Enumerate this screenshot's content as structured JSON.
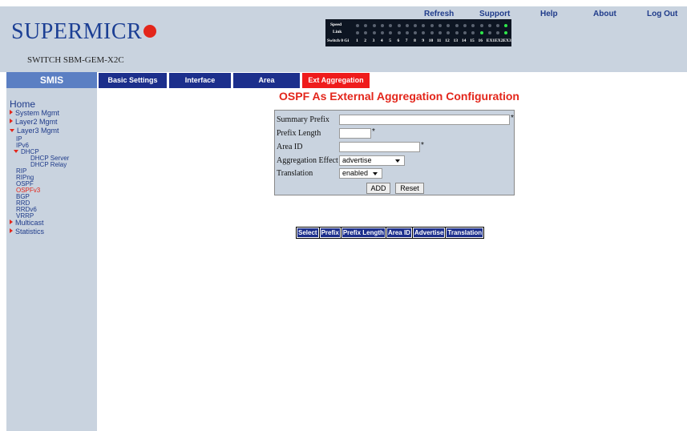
{
  "brand": {
    "logo_text": "SUPERMICR",
    "switch_name": "SWITCH SBM-GEM-X2C"
  },
  "top_links": [
    "Refresh",
    "Support",
    "Help",
    "About",
    "Log Out"
  ],
  "port_panel": {
    "speed_label": "Speed",
    "link_label": "Link",
    "switch_label": "Switch 0 Gi",
    "ports": [
      "1",
      "2",
      "3",
      "4",
      "5",
      "6",
      "7",
      "8",
      "9",
      "10",
      "11",
      "12",
      "13",
      "14",
      "15",
      "16",
      "EX1",
      "EX2",
      "EX3"
    ],
    "speed_on": [
      18
    ],
    "link_on": [
      15,
      18
    ]
  },
  "sidebar": {
    "title": "SMIS",
    "home": "Home",
    "items": [
      {
        "label": "System Mgmt",
        "arrow": "right"
      },
      {
        "label": "Layer2 Mgmt",
        "arrow": "right"
      },
      {
        "label": "Layer3 Mgmt",
        "arrow": "down"
      }
    ],
    "layer3_sub": [
      "IP",
      "IPv6"
    ],
    "dhcp": "DHCP",
    "dhcp_sub": [
      "DHCP Server",
      "DHCP Relay"
    ],
    "layer3_more": [
      "RIP",
      "RIPng",
      "OSPF",
      "OSPFv3",
      "BGP",
      "RRD",
      "RRDv6",
      "VRRP"
    ],
    "active_sub": "OSPFv3",
    "bottom": [
      {
        "label": "Multicast",
        "arrow": "right"
      },
      {
        "label": "Statistics",
        "arrow": "right"
      }
    ]
  },
  "tabs": [
    {
      "label": "Basic Settings",
      "active": false
    },
    {
      "label": "Interface",
      "active": false
    },
    {
      "label": "Area",
      "active": false
    },
    {
      "label": "Ext Aggregation",
      "active": true
    }
  ],
  "page_title": "OSPF As External Aggregation Configuration",
  "form": {
    "summary_prefix_label": "Summary Prefix",
    "summary_prefix_value": "",
    "prefix_length_label": "Prefix Length",
    "prefix_length_value": "",
    "area_id_label": "Area ID",
    "area_id_value": "",
    "aggregation_effect_label": "Aggregation Effect",
    "aggregation_effect_value": "advertise",
    "translation_label": "Translation",
    "translation_value": "enabled",
    "required_mark": "*",
    "add_button": "ADD",
    "reset_button": "Reset"
  },
  "table": {
    "headers": [
      "Select",
      "Prefix",
      "Prefix Length",
      "Area ID",
      "Advertise",
      "Translation"
    ]
  },
  "colors": {
    "header_bg": "#c9d3df",
    "tab_bg": "#1c2f8c",
    "tab_active": "#ef1b1b",
    "title_red": "#e3261b",
    "link_blue": "#1f3b8a"
  }
}
